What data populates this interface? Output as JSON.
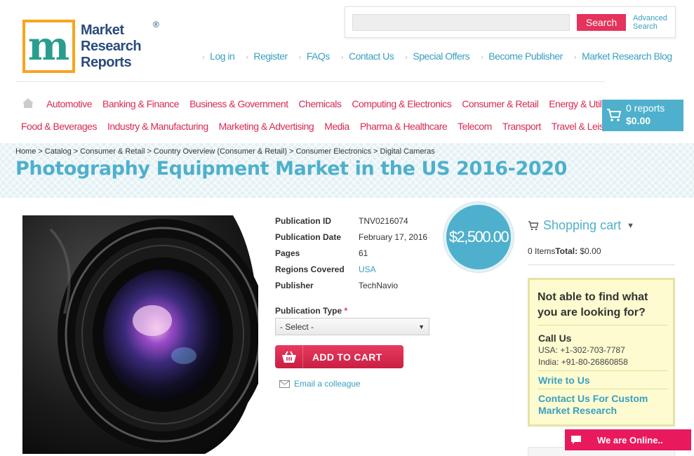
{
  "header": {
    "logo_text": [
      "Market",
      "Research",
      "Reports"
    ],
    "logo_reg": "®",
    "search_placeholder": "",
    "search_button": "Search",
    "advanced_search": [
      "Advanced",
      "Search"
    ],
    "top_links": [
      "Log in",
      "Register",
      "FAQs",
      "Contact Us",
      "Special Offers",
      "Become Publisher",
      "Market Research Blog"
    ]
  },
  "nav": {
    "row1": [
      "Automotive",
      "Banking & Finance",
      "Business & Government",
      "Chemicals",
      "Computing & Electronics",
      "Consumer & Retail",
      "Energy & Utilities"
    ],
    "row2": [
      "Food & Beverages",
      "Industry & Manufacturing",
      "Marketing & Advertising",
      "Media",
      "Pharma & Healthcare",
      "Telecom",
      "Transport",
      "Travel & Leisure"
    ]
  },
  "cart": {
    "count": "0 reports",
    "total": "$0.00"
  },
  "breadcrumb": [
    "Home",
    "Catalog",
    "Consumer & Retail",
    "Country Overview (Consumer & Retail)",
    "Consumer Electronics",
    "Digital Cameras"
  ],
  "page_title": "Photography Equipment Market in the US 2016-2020",
  "product": {
    "fields": [
      {
        "label": "Publication ID",
        "value": "TNV0216074"
      },
      {
        "label": "Publication Date",
        "value": "February 17, 2016"
      },
      {
        "label": "Pages",
        "value": "61"
      },
      {
        "label": "Regions Covered",
        "value": "USA"
      },
      {
        "label": "Publisher",
        "value": "TechNavio"
      }
    ],
    "price": "$2,500.00",
    "publication_type_label": "Publication Type",
    "required_mark": "*",
    "select_value": "- Select -",
    "add_to_cart": "ADD TO CART",
    "email_colleague": "Email a colleague"
  },
  "sidebar": {
    "shopping_cart_title": "Shopping cart",
    "items_text": "0 Items",
    "total_label": "Total:",
    "total_value": "$0.00",
    "help_question": "Not able to find what you are looking for?",
    "call_us": "Call Us",
    "phone_usa": "USA: +1-302-703-7787",
    "phone_india": "India: +91-80-26860858",
    "write_to_us": "Write to Us",
    "contact_custom": "Contact Us For Custom Market Research"
  },
  "chat": {
    "label": "We are Online.."
  },
  "colors": {
    "accent_blue": "#4eb0cc",
    "accent_pink": "#e5335b",
    "link_blue": "#3a9fc2",
    "nav_red": "#d62b53"
  }
}
